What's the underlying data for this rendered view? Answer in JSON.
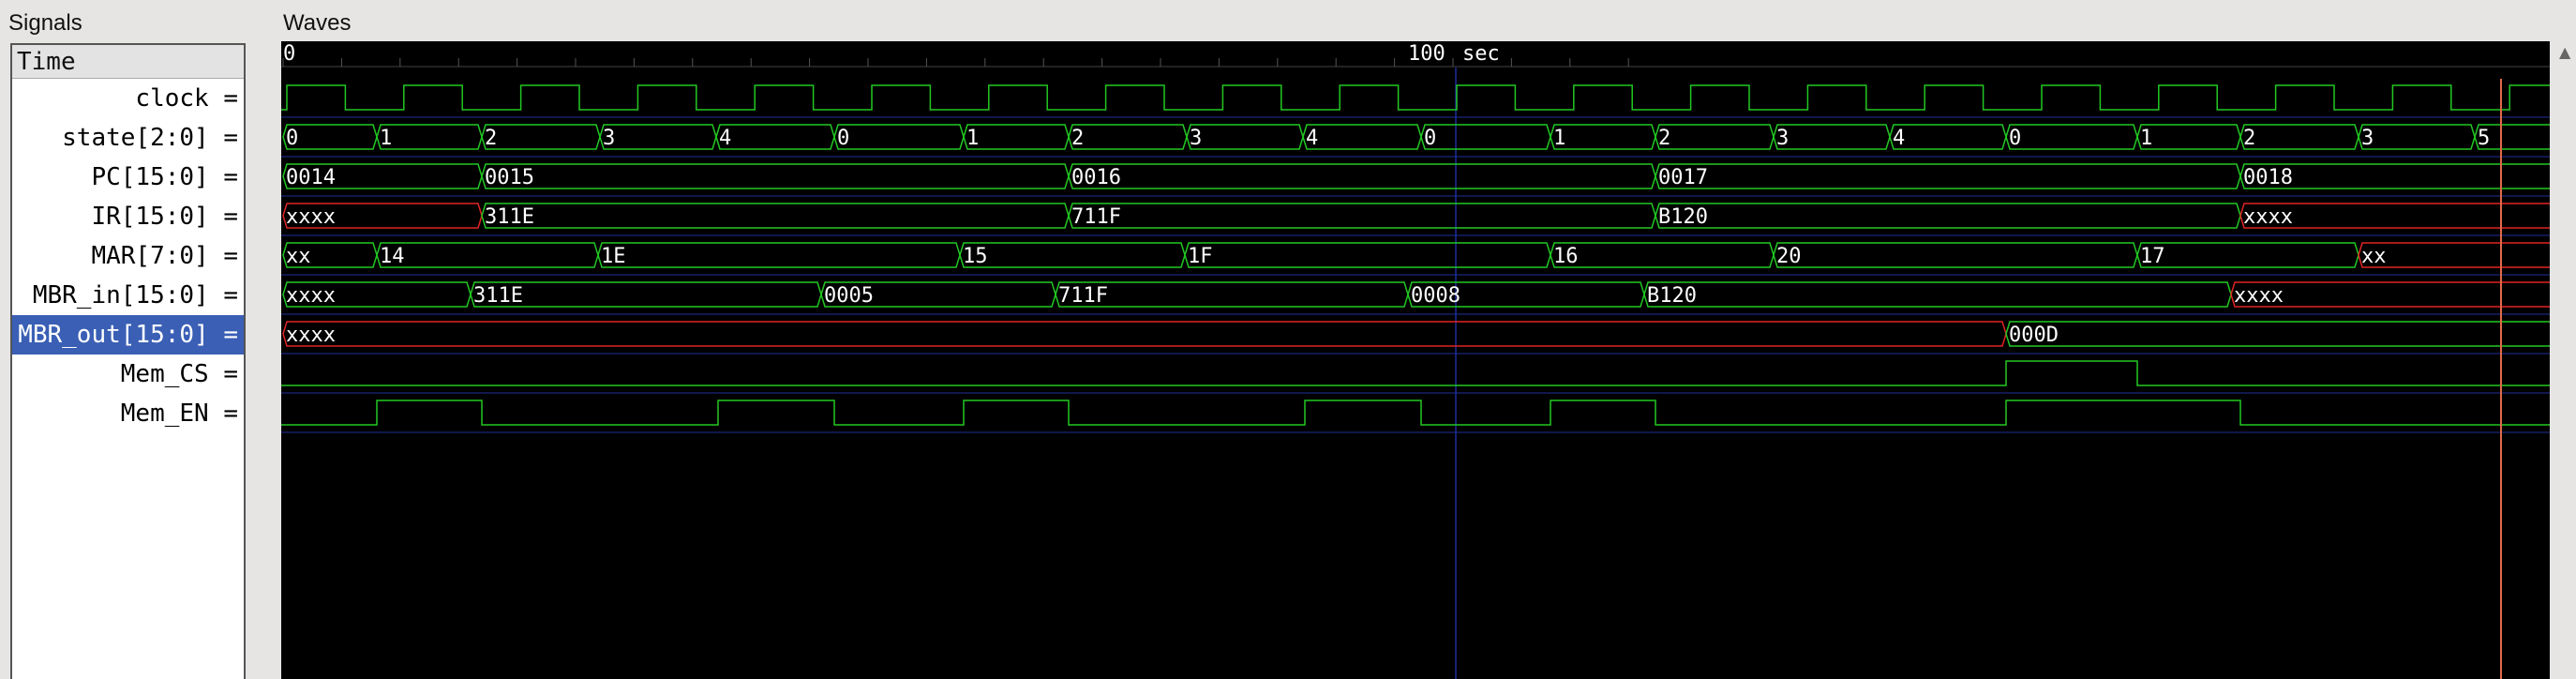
{
  "panels": {
    "signals_title": "Signals",
    "waves_title": "Waves"
  },
  "time_header": "Time",
  "timeline": {
    "start_label": "0",
    "mid_label": "100",
    "unit": "sec"
  },
  "selected_signal": "MBR_out[15:0]",
  "signals": [
    {
      "name": "clock =",
      "type": "clock"
    },
    {
      "name": "state[2:0] =",
      "type": "bus",
      "values": [
        "0",
        "1",
        "2",
        "3",
        "4",
        "0",
        "1",
        "2",
        "3",
        "4",
        "0",
        "1",
        "2",
        "3",
        "4",
        "0",
        "1",
        "2",
        "3",
        "5"
      ]
    },
    {
      "name": "PC[15:0] =",
      "type": "bus",
      "values": [
        "0014",
        "0015",
        "0016",
        "0017",
        "0018"
      ]
    },
    {
      "name": "IR[15:0] =",
      "type": "bus",
      "values": [
        "xxxx",
        "311E",
        "711F",
        "B120",
        "xxxx"
      ]
    },
    {
      "name": "MAR[7:0] =",
      "type": "bus",
      "values": [
        "xx",
        "14",
        "1E",
        "15",
        "1F",
        "16",
        "20",
        "17",
        "xx"
      ]
    },
    {
      "name": "MBR_in[15:0] =",
      "type": "bus",
      "values": [
        "xxxx",
        "311E",
        "0005",
        "711F",
        "0008",
        "B120",
        "xxxx"
      ]
    },
    {
      "name": "MBR_out[15:0] =",
      "type": "bus",
      "values": [
        "xxxx",
        "000D"
      ]
    },
    {
      "name": "Mem_CS =",
      "type": "bit"
    },
    {
      "name": "Mem_EN =",
      "type": "bit"
    }
  ],
  "colors": {
    "background": "#000000",
    "wave": "#22c722",
    "undefined": "#e02424",
    "grid": "#1f2f9a",
    "cursor": "#e06a4a",
    "selected": "#3a5fb5",
    "text": "#ffffff"
  }
}
